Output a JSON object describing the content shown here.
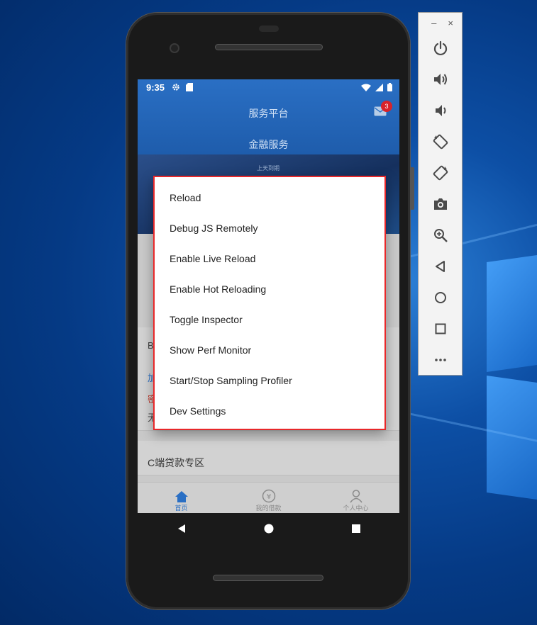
{
  "status_bar": {
    "time": "9:35"
  },
  "app": {
    "header_title": "服务平台",
    "header_subtitle": "金融服务",
    "mail_badge_count": "3",
    "banner_text": "上天到期",
    "section_letter": "B",
    "background_fragments": [
      "加",
      "密",
      "无"
    ],
    "c_zone_title": "C端贷款专区",
    "tabs": [
      {
        "label": "首页",
        "icon": "home-icon",
        "active": true
      },
      {
        "label": "我的借款",
        "icon": "yen-coin-icon",
        "active": false
      },
      {
        "label": "个人中心",
        "icon": "user-icon",
        "active": false
      }
    ]
  },
  "dev_menu": {
    "items": [
      "Reload",
      "Debug JS Remotely",
      "Enable Live Reload",
      "Enable Hot Reloading",
      "Toggle Inspector",
      "Show Perf Monitor",
      "Start/Stop Sampling Profiler",
      "Dev Settings"
    ]
  },
  "emulator_toolbar": {
    "minimize_label": "–",
    "close_label": "×",
    "buttons": [
      "power-icon",
      "volume-up-icon",
      "volume-down-icon",
      "rotate-left-icon",
      "rotate-right-icon",
      "camera-icon",
      "zoom-icon",
      "back-icon",
      "home-circle-icon",
      "overview-icon",
      "more-icon"
    ]
  },
  "colors": {
    "accent": "#2a6fc4",
    "menu_border": "#e8282a",
    "badge": "#d8232a"
  }
}
